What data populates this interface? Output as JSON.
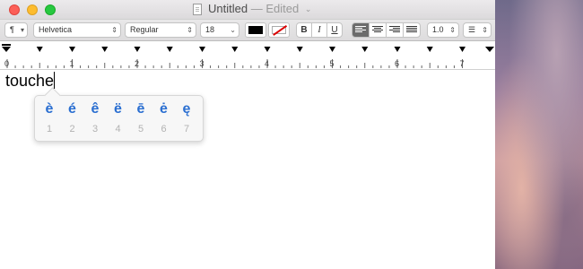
{
  "window": {
    "title": "Untitled",
    "title_status": "— Edited",
    "title_chevron": "⌄"
  },
  "toolbar": {
    "paragraph_style": "¶",
    "font_family": "Helvetica",
    "typeface": "Regular",
    "font_size": "18",
    "text_color": "#000000",
    "highlight_color": "none",
    "bold": "B",
    "italic": "I",
    "underline": "U",
    "alignment_selected": "left",
    "line_spacing": "1.0",
    "list_style": "list"
  },
  "ruler": {
    "numbers": [
      "0",
      "1",
      "2",
      "3",
      "4",
      "5",
      "6",
      "7"
    ]
  },
  "document": {
    "text": "touche"
  },
  "accent_popup": {
    "options": [
      {
        "char": "è",
        "key": "1"
      },
      {
        "char": "é",
        "key": "2"
      },
      {
        "char": "ê",
        "key": "3"
      },
      {
        "char": "ë",
        "key": "4"
      },
      {
        "char": "ē",
        "key": "5"
      },
      {
        "char": "ė",
        "key": "6"
      },
      {
        "char": "ę",
        "key": "7"
      }
    ]
  },
  "colors": {
    "accent_text": "#2b6fd1",
    "close": "#fc5f57",
    "minimize": "#fdbc2e",
    "zoom": "#27c840"
  }
}
